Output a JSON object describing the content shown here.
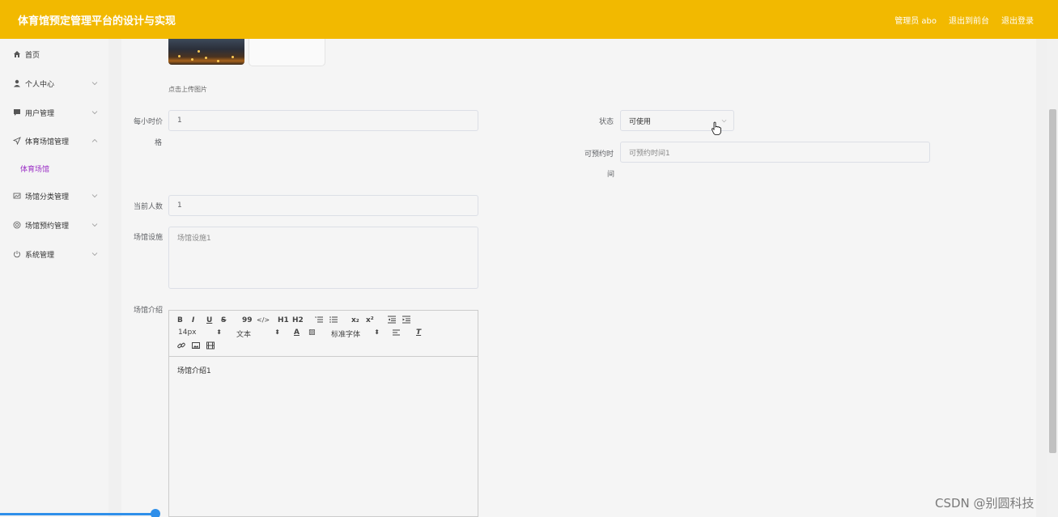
{
  "header": {
    "title": "体育馆预定管理平台的设计与实现",
    "admin_label": "管理员 abo",
    "back_label": "退出到前台",
    "logout_label": "退出登录"
  },
  "sidebar": {
    "items": [
      {
        "label": "首页",
        "icon": "home-icon"
      },
      {
        "label": "个人中心",
        "icon": "user-icon"
      },
      {
        "label": "用户管理",
        "icon": "chat-icon"
      },
      {
        "label": "体育场馆管理",
        "icon": "navigation-icon"
      },
      {
        "label": "场馆分类管理",
        "icon": "chart-icon"
      },
      {
        "label": "场馆预约管理",
        "icon": "globe-icon"
      },
      {
        "label": "系统管理",
        "icon": "power-icon"
      }
    ],
    "sub_item": "体育场馆",
    "active_color": "#9b2fc6"
  },
  "form": {
    "upload_hint": "点击上传图片",
    "price_label_1": "每小时价",
    "price_label_2": "格",
    "price_value": "1",
    "status_label": "状态",
    "status_value": "可使用",
    "time_label_1": "可预约时",
    "time_label_2": "间",
    "time_placeholder": "可预约时间1",
    "count_label": "当前人数",
    "count_value": "1",
    "facility_label": "场馆设施",
    "facility_placeholder": "场馆设施1",
    "intro_label": "场馆介绍"
  },
  "editor": {
    "toolbar_row1": [
      "B",
      "I",
      "U",
      "S",
      "99",
      "</>",
      "H1",
      "H2",
      "ol",
      "ul",
      "x₂",
      "x²",
      "outdent",
      "indent"
    ],
    "font_size": "14px",
    "text_style": "文本",
    "font_family": "标准字体",
    "content": "场馆介绍1"
  },
  "watermark": "CSDN @别圆科技",
  "colors": {
    "header_bg": "#f2b900",
    "accent_blue": "#2f8fea"
  }
}
